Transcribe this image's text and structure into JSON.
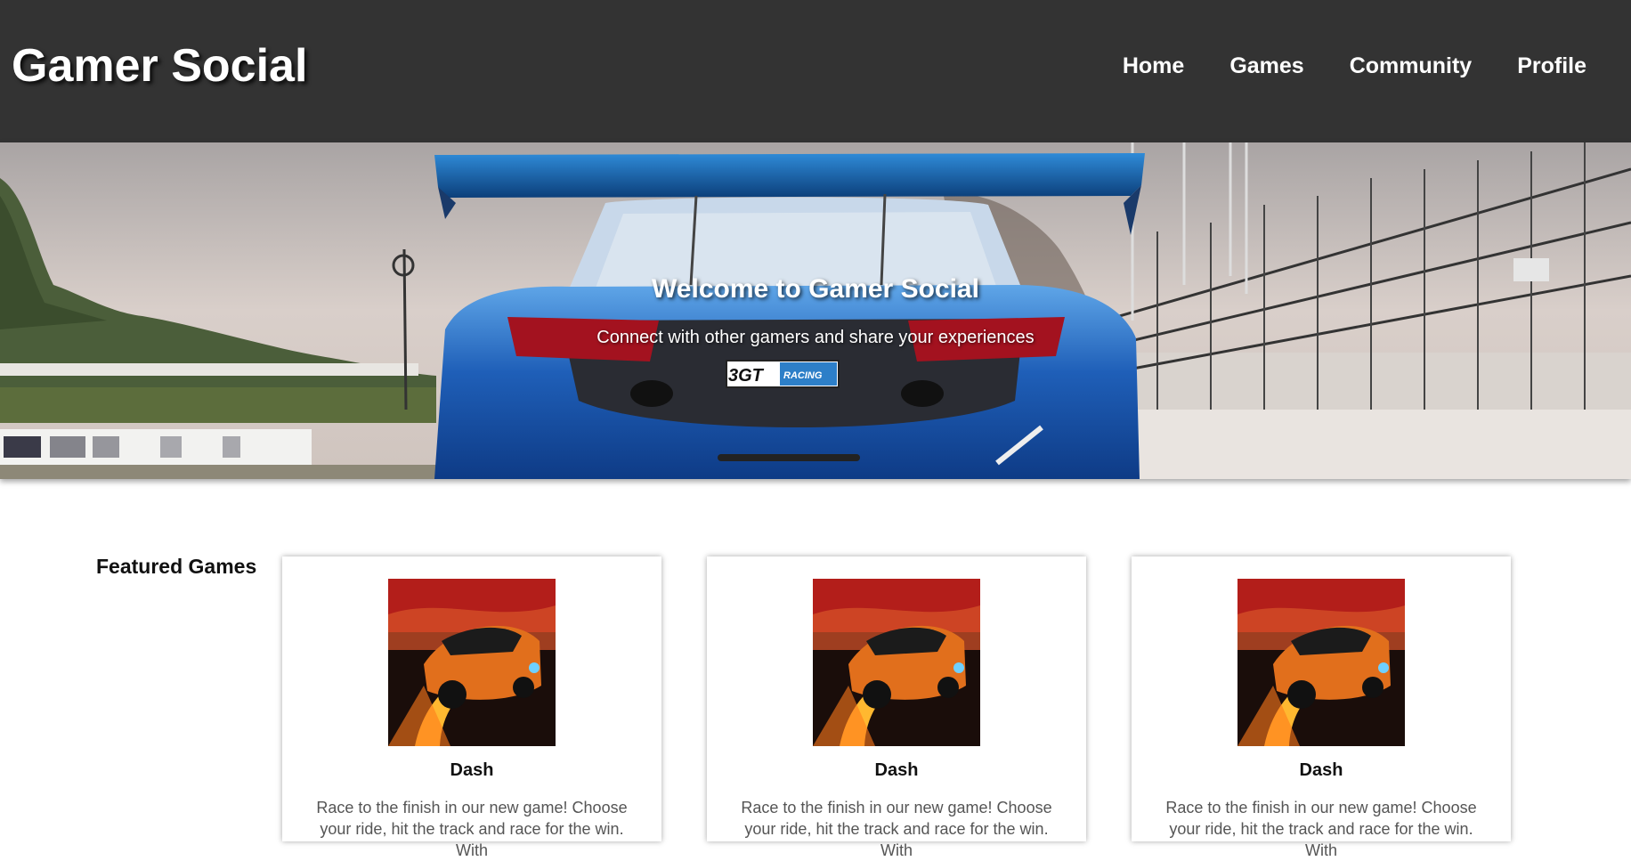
{
  "header": {
    "site_title": "Gamer Social",
    "nav": [
      "Home",
      "Games",
      "Community",
      "Profile"
    ]
  },
  "hero": {
    "title": "Welcome to Gamer Social",
    "subtitle": "Connect with other gamers and share your experiences",
    "badge_text": "3GT",
    "badge_sub": "RACING"
  },
  "featured": {
    "heading": "Featured Games",
    "cards": [
      {
        "title": "Dash",
        "description": "Race to the finish in our new game! Choose your ride, hit the track and race for the win. With"
      },
      {
        "title": "Dash",
        "description": "Race to the finish in our new game! Choose your ride, hit the track and race for the win. With"
      },
      {
        "title": "Dash",
        "description": "Race to the finish in our new game! Choose your ride, hit the track and race for the win. With"
      }
    ]
  },
  "colors": {
    "header_bg": "#333333",
    "car_blue": "#1f5fb8",
    "text_muted": "#555555"
  }
}
